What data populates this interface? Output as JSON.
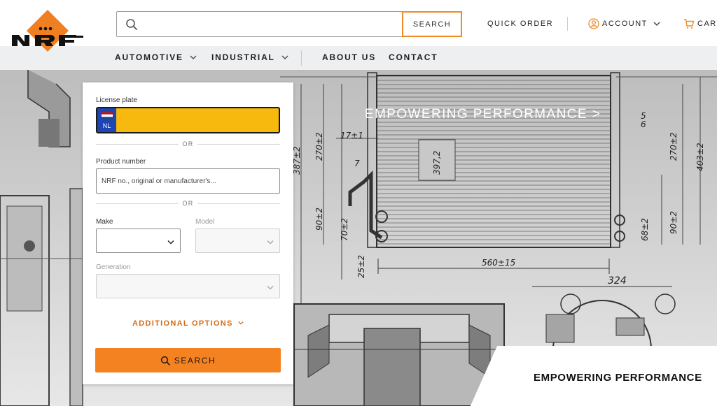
{
  "brand": {
    "logo_text": "NRF",
    "accent": "#f58220",
    "logo_color": "#f07f22"
  },
  "header": {
    "search_placeholder": "",
    "search_button": "SEARCH",
    "quick_order": "QUICK ORDER",
    "account": "ACCOUNT",
    "cart": "CART"
  },
  "nav": {
    "items": [
      {
        "label": "AUTOMOTIVE",
        "has_dropdown": true
      },
      {
        "label": "INDUSTRIAL",
        "has_dropdown": true
      },
      {
        "label": "ABOUT US",
        "has_dropdown": false
      },
      {
        "label": "CONTACT",
        "has_dropdown": false
      }
    ]
  },
  "hero": {
    "link": "EMPOWERING PERFORMANCE >",
    "card_text": "EMPOWERING PERFORMANCE",
    "drawing_labels": [
      "387±2",
      "270±2",
      "90±2",
      "70±2",
      "25±2",
      "17±1",
      "7",
      "397,2",
      "560±15",
      "324",
      "270±2",
      "403±2",
      "90±2",
      "68±2",
      "5",
      "6"
    ]
  },
  "finder": {
    "license_label": "License plate",
    "plate_country": "NL",
    "plate_value": "",
    "or_1": "OR",
    "product_label": "Product number",
    "product_placeholder": "NRF no., original or manufacturer's...",
    "or_2": "OR",
    "make_label": "Make",
    "make_value": "",
    "model_label": "Model",
    "generation_label": "Generation",
    "additional_options": "ADDITIONAL OPTIONS",
    "search_button": "SEARCH"
  }
}
